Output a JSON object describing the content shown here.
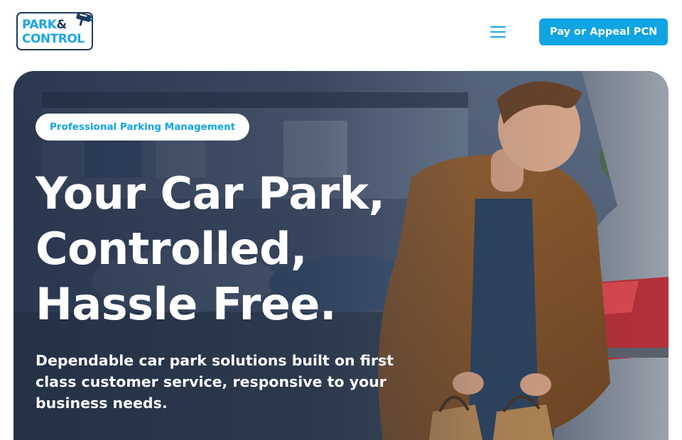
{
  "header": {
    "logo": {
      "line1": "PARK",
      "amp": "&",
      "line2": "CONTROL"
    },
    "menu_icon": "hamburger-menu-icon",
    "cta_label": "Pay or Appeal PCN"
  },
  "hero": {
    "badge": "Professional Parking Management",
    "headline": [
      "Your Car Park,",
      "Controlled,",
      "Hassle Free."
    ],
    "subheading": "Dependable car park solutions built on first class customer service, responsive to your business needs."
  },
  "colors": {
    "accent": "#10a4e3",
    "logo_dark": "#1f3a5f",
    "hero_overlay": "#1c2a42"
  }
}
